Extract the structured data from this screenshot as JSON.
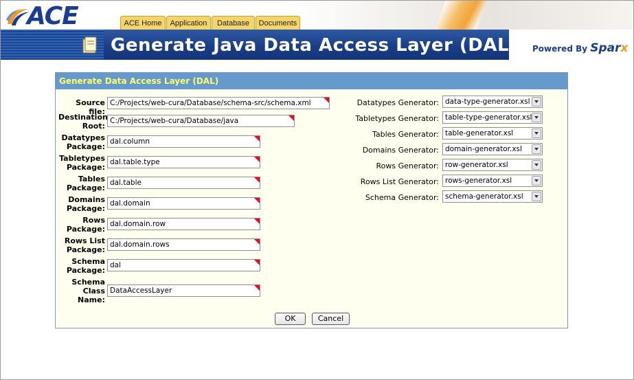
{
  "brand": {
    "logo_text": "ACE",
    "powered_by": "Powered By",
    "powered_brand": "Spar",
    "powered_brand_x": "x"
  },
  "tabs": [
    {
      "label": "ACE Home"
    },
    {
      "label": "Application"
    },
    {
      "label": "Database"
    },
    {
      "label": "Documents"
    }
  ],
  "page_title": "Generate Java Data Access Layer (DAL)",
  "panel": {
    "title": "Generate Data Access Layer (DAL)",
    "left_fields": [
      {
        "label": "Source file:",
        "value": "C:/Projects/web-cura/Database/schema-src/schema.xml"
      },
      {
        "label": "Destination Root:",
        "value": "C:/Projects/web-cura/Database/java"
      },
      {
        "label": "Datatypes Package:",
        "value": "dal.column"
      },
      {
        "label": "Tabletypes Package:",
        "value": "dal.table.type"
      },
      {
        "label": "Tables Package:",
        "value": "dal.table"
      },
      {
        "label": "Domains Package:",
        "value": "dal.domain"
      },
      {
        "label": "Rows Package:",
        "value": "dal.domain.row"
      },
      {
        "label": "Rows List Package:",
        "value": "dal.domain.rows"
      },
      {
        "label": "Schema Package:",
        "value": "dal"
      },
      {
        "label": "Schema Class Name:",
        "value": "DataAccessLayer"
      }
    ],
    "right_fields": [
      {
        "label": "Datatypes Generator:",
        "value": "data-type-generator.xsl"
      },
      {
        "label": "Tabletypes Generator:",
        "value": "table-type-generator.xsl"
      },
      {
        "label": "Tables Generator:",
        "value": "table-generator.xsl"
      },
      {
        "label": "Domains Generator:",
        "value": "domain-generator.xsl"
      },
      {
        "label": "Rows Generator:",
        "value": "row-generator.xsl"
      },
      {
        "label": "Rows List Generator:",
        "value": "rows-generator.xsl"
      },
      {
        "label": "Schema Generator:",
        "value": "schema-generator.xsl"
      }
    ],
    "ok_label": "OK",
    "cancel_label": "Cancel"
  }
}
